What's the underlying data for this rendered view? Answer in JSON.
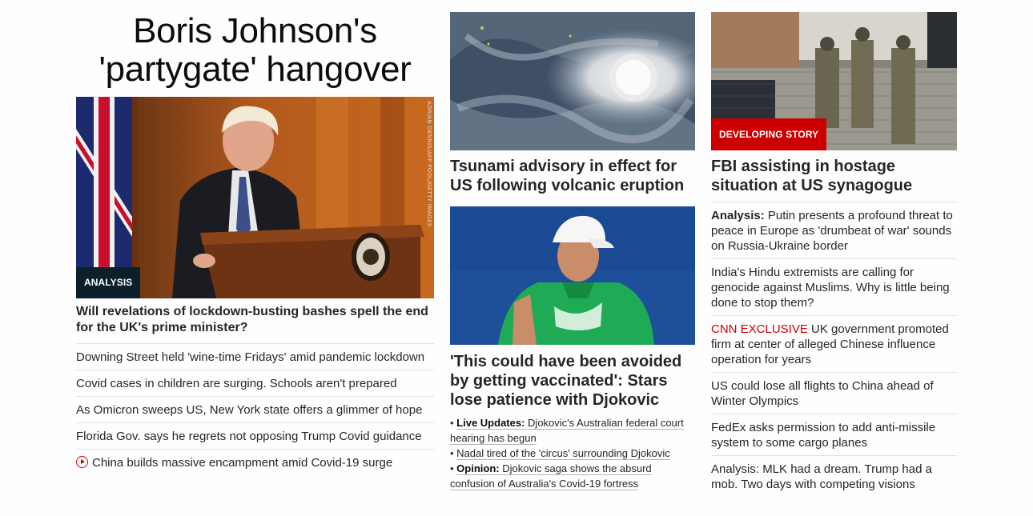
{
  "left": {
    "title": "Boris Johnson's 'partygate' hangover",
    "image": {
      "alt": "Boris Johnson at podium",
      "credit": "ADRIAN DENNIS/AFP POOL/GETTY IMAGES",
      "badge": "ANALYSIS"
    },
    "headline": "Will revelations of lockdown-busting bashes spell the end for the UK's prime minister?",
    "items": [
      {
        "text": "Downing Street held 'wine-time Fridays' amid pandemic lockdown"
      },
      {
        "text": "Covid cases in children are surging. Schools aren't prepared"
      },
      {
        "text": "As Omicron sweeps US, New York state offers a glimmer of hope"
      },
      {
        "text": "Florida Gov. says he regrets not opposing Trump Covid guidance"
      },
      {
        "text": "China builds massive encampment amid Covid-19 surge",
        "icon": "play-video-icon"
      }
    ]
  },
  "middle": {
    "story1": {
      "image": {
        "alt": "Satellite view of volcanic eruption"
      },
      "headline": "Tsunami advisory in effect for US following volcanic eruption"
    },
    "story2": {
      "image": {
        "alt": "Novak Djokovic in green shirt and white cap"
      },
      "headline": "'This could have been avoided by getting vaccinated': Stars lose patience with Djokovic",
      "bullets": [
        {
          "prefix": "Live Updates:",
          "text": "Djokovic's Australian federal court hearing has begun"
        },
        {
          "prefix": "",
          "text": "Nadal tired of the 'circus' surrounding Djokovic"
        },
        {
          "prefix": "Opinion:",
          "text": "Djokovic saga shows the absurd confusion of Australia's Covid-19 fortress"
        }
      ]
    }
  },
  "right": {
    "image": {
      "alt": "Police officers outside synagogue",
      "badge": "DEVELOPING STORY"
    },
    "headline": "FBI assisting in hostage situation at US synagogue",
    "items": [
      {
        "prefix": "Analysis:",
        "text": "Putin presents a profound threat to peace in Europe as 'drumbeat of war' sounds on Russia-Ukraine border"
      },
      {
        "prefix": "",
        "text": "India's Hindu extremists are calling for genocide against Muslims. Why is little being done to stop them?"
      },
      {
        "exclusive": "CNN EXCLUSIVE",
        "text": "UK government promoted firm at center of alleged Chinese influence operation for years"
      },
      {
        "prefix": "",
        "text": "US could lose all flights to China ahead of Winter Olympics"
      },
      {
        "prefix": "",
        "text": "FedEx asks permission to add anti-missile system to some cargo planes"
      },
      {
        "prefix": "",
        "text": "Analysis: MLK had a dream. Trump had a mob. Two days with competing visions"
      }
    ]
  },
  "colors": {
    "accent": "#cc0000",
    "analysis_badge": "#0c1f2b",
    "text": "#262626"
  }
}
